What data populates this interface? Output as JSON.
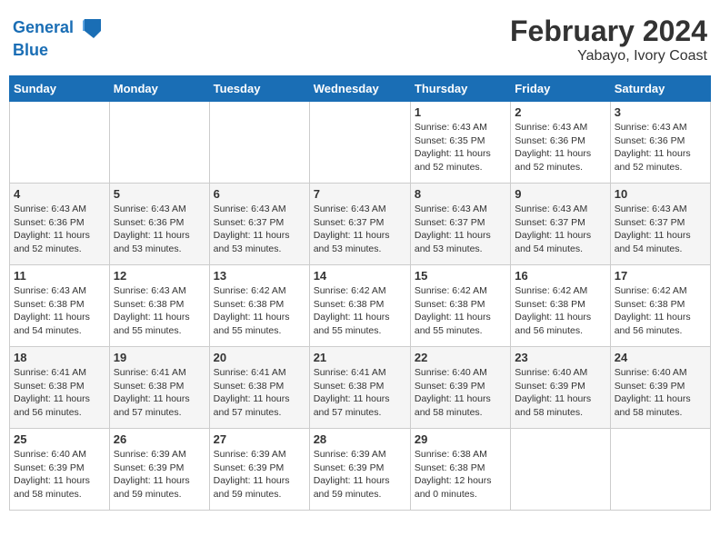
{
  "header": {
    "logo_line1": "General",
    "logo_line2": "Blue",
    "month": "February 2024",
    "location": "Yabayo, Ivory Coast"
  },
  "weekdays": [
    "Sunday",
    "Monday",
    "Tuesday",
    "Wednesday",
    "Thursday",
    "Friday",
    "Saturday"
  ],
  "weeks": [
    [
      {
        "day": "",
        "info": ""
      },
      {
        "day": "",
        "info": ""
      },
      {
        "day": "",
        "info": ""
      },
      {
        "day": "",
        "info": ""
      },
      {
        "day": "1",
        "info": "Sunrise: 6:43 AM\nSunset: 6:35 PM\nDaylight: 11 hours\nand 52 minutes."
      },
      {
        "day": "2",
        "info": "Sunrise: 6:43 AM\nSunset: 6:36 PM\nDaylight: 11 hours\nand 52 minutes."
      },
      {
        "day": "3",
        "info": "Sunrise: 6:43 AM\nSunset: 6:36 PM\nDaylight: 11 hours\nand 52 minutes."
      }
    ],
    [
      {
        "day": "4",
        "info": "Sunrise: 6:43 AM\nSunset: 6:36 PM\nDaylight: 11 hours\nand 52 minutes."
      },
      {
        "day": "5",
        "info": "Sunrise: 6:43 AM\nSunset: 6:36 PM\nDaylight: 11 hours\nand 53 minutes."
      },
      {
        "day": "6",
        "info": "Sunrise: 6:43 AM\nSunset: 6:37 PM\nDaylight: 11 hours\nand 53 minutes."
      },
      {
        "day": "7",
        "info": "Sunrise: 6:43 AM\nSunset: 6:37 PM\nDaylight: 11 hours\nand 53 minutes."
      },
      {
        "day": "8",
        "info": "Sunrise: 6:43 AM\nSunset: 6:37 PM\nDaylight: 11 hours\nand 53 minutes."
      },
      {
        "day": "9",
        "info": "Sunrise: 6:43 AM\nSunset: 6:37 PM\nDaylight: 11 hours\nand 54 minutes."
      },
      {
        "day": "10",
        "info": "Sunrise: 6:43 AM\nSunset: 6:37 PM\nDaylight: 11 hours\nand 54 minutes."
      }
    ],
    [
      {
        "day": "11",
        "info": "Sunrise: 6:43 AM\nSunset: 6:38 PM\nDaylight: 11 hours\nand 54 minutes."
      },
      {
        "day": "12",
        "info": "Sunrise: 6:43 AM\nSunset: 6:38 PM\nDaylight: 11 hours\nand 55 minutes."
      },
      {
        "day": "13",
        "info": "Sunrise: 6:42 AM\nSunset: 6:38 PM\nDaylight: 11 hours\nand 55 minutes."
      },
      {
        "day": "14",
        "info": "Sunrise: 6:42 AM\nSunset: 6:38 PM\nDaylight: 11 hours\nand 55 minutes."
      },
      {
        "day": "15",
        "info": "Sunrise: 6:42 AM\nSunset: 6:38 PM\nDaylight: 11 hours\nand 55 minutes."
      },
      {
        "day": "16",
        "info": "Sunrise: 6:42 AM\nSunset: 6:38 PM\nDaylight: 11 hours\nand 56 minutes."
      },
      {
        "day": "17",
        "info": "Sunrise: 6:42 AM\nSunset: 6:38 PM\nDaylight: 11 hours\nand 56 minutes."
      }
    ],
    [
      {
        "day": "18",
        "info": "Sunrise: 6:41 AM\nSunset: 6:38 PM\nDaylight: 11 hours\nand 56 minutes."
      },
      {
        "day": "19",
        "info": "Sunrise: 6:41 AM\nSunset: 6:38 PM\nDaylight: 11 hours\nand 57 minutes."
      },
      {
        "day": "20",
        "info": "Sunrise: 6:41 AM\nSunset: 6:38 PM\nDaylight: 11 hours\nand 57 minutes."
      },
      {
        "day": "21",
        "info": "Sunrise: 6:41 AM\nSunset: 6:38 PM\nDaylight: 11 hours\nand 57 minutes."
      },
      {
        "day": "22",
        "info": "Sunrise: 6:40 AM\nSunset: 6:39 PM\nDaylight: 11 hours\nand 58 minutes."
      },
      {
        "day": "23",
        "info": "Sunrise: 6:40 AM\nSunset: 6:39 PM\nDaylight: 11 hours\nand 58 minutes."
      },
      {
        "day": "24",
        "info": "Sunrise: 6:40 AM\nSunset: 6:39 PM\nDaylight: 11 hours\nand 58 minutes."
      }
    ],
    [
      {
        "day": "25",
        "info": "Sunrise: 6:40 AM\nSunset: 6:39 PM\nDaylight: 11 hours\nand 58 minutes."
      },
      {
        "day": "26",
        "info": "Sunrise: 6:39 AM\nSunset: 6:39 PM\nDaylight: 11 hours\nand 59 minutes."
      },
      {
        "day": "27",
        "info": "Sunrise: 6:39 AM\nSunset: 6:39 PM\nDaylight: 11 hours\nand 59 minutes."
      },
      {
        "day": "28",
        "info": "Sunrise: 6:39 AM\nSunset: 6:39 PM\nDaylight: 11 hours\nand 59 minutes."
      },
      {
        "day": "29",
        "info": "Sunrise: 6:38 AM\nSunset: 6:38 PM\nDaylight: 12 hours\nand 0 minutes."
      },
      {
        "day": "",
        "info": ""
      },
      {
        "day": "",
        "info": ""
      }
    ]
  ]
}
